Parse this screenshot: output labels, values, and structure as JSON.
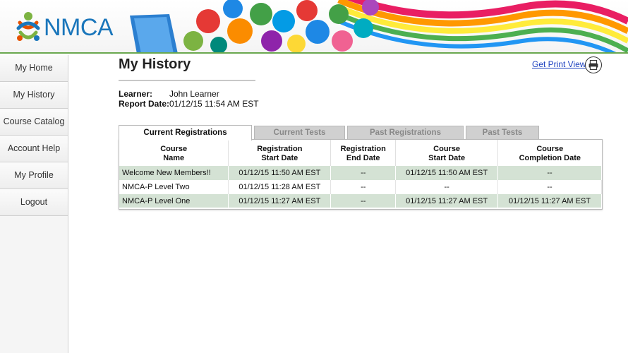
{
  "header": {
    "logo_text": "NMCA"
  },
  "sidebar": {
    "items": [
      {
        "label": "My Home"
      },
      {
        "label": "My History"
      },
      {
        "label": "Course Catalog"
      },
      {
        "label": "Account Help"
      },
      {
        "label": "My Profile"
      },
      {
        "label": "Logout"
      }
    ]
  },
  "main": {
    "title": "My History",
    "print_label": "Get Print View",
    "learner_label": "Learner:",
    "learner_value": "John Learner",
    "report_date_label": "Report Date:",
    "report_date_value": "01/12/15 11:54 AM EST",
    "tabs": [
      {
        "label": "Current Registrations",
        "active": true
      },
      {
        "label": "Current Tests",
        "active": false
      },
      {
        "label": "Past Registrations",
        "active": false
      },
      {
        "label": "Past Tests",
        "active": false
      }
    ],
    "table": {
      "headers": [
        [
          "Course",
          "Name"
        ],
        [
          "Registration",
          "Start Date"
        ],
        [
          "Registration",
          "End Date"
        ],
        [
          "Course",
          "Start Date"
        ],
        [
          "Course",
          "Completion Date"
        ]
      ],
      "rows": [
        [
          "Welcome New Members!!",
          "01/12/15 11:50 AM EST",
          "--",
          "01/12/15 11:50 AM EST",
          "--"
        ],
        [
          "NMCA-P Level Two",
          "01/12/15 11:28 AM EST",
          "--",
          "--",
          "--"
        ],
        [
          "NMCA-P Level One",
          "01/12/15 11:27 AM EST",
          "--",
          "01/12/15 11:27 AM EST",
          "01/12/15 11:27 AM EST"
        ]
      ]
    }
  },
  "colors": {
    "accent_green": "#6aa84f",
    "logo_blue": "#1a76bb",
    "row_shade": "#d4e2d4",
    "link_blue": "#1a3fbf"
  }
}
